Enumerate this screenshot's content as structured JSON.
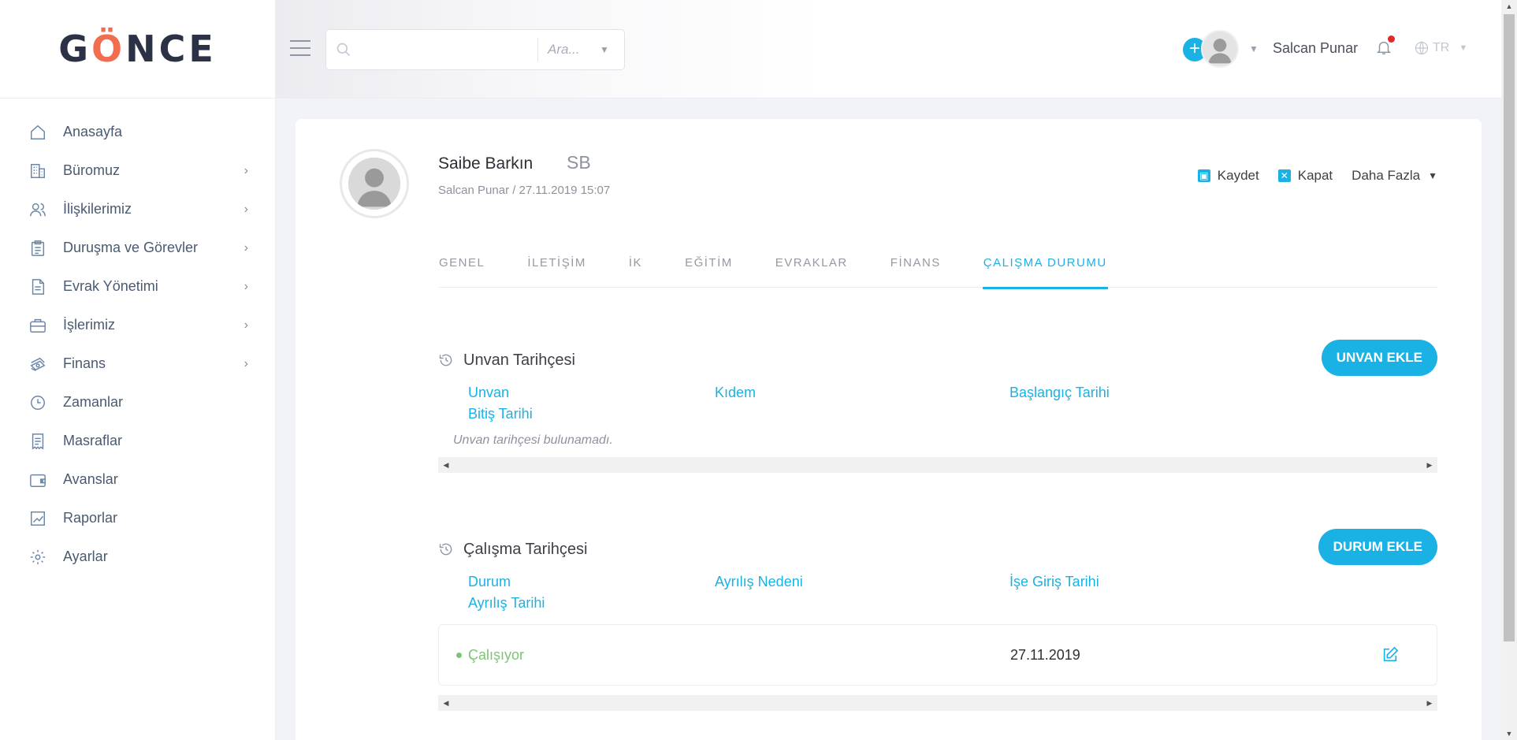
{
  "brand": {
    "logo_text_1": "G",
    "logo_text_2": "NCE"
  },
  "sidebar": {
    "items": [
      {
        "label": "Anasayfa",
        "icon": "home-icon",
        "has_children": false
      },
      {
        "label": "Büromuz",
        "icon": "building-icon",
        "has_children": true
      },
      {
        "label": "İlişkilerimiz",
        "icon": "users-icon",
        "has_children": true
      },
      {
        "label": "Duruşma ve Görevler",
        "icon": "clipboard-icon",
        "has_children": true
      },
      {
        "label": "Evrak Yönetimi",
        "icon": "document-icon",
        "has_children": true
      },
      {
        "label": "İşlerimiz",
        "icon": "briefcase-icon",
        "has_children": true
      },
      {
        "label": "Finans",
        "icon": "money-icon",
        "has_children": true
      },
      {
        "label": "Zamanlar",
        "icon": "clock-icon",
        "has_children": false
      },
      {
        "label": "Masraflar",
        "icon": "receipt-icon",
        "has_children": false
      },
      {
        "label": "Avanslar",
        "icon": "wallet-icon",
        "has_children": false
      },
      {
        "label": "Raporlar",
        "icon": "chart-icon",
        "has_children": false
      },
      {
        "label": "Ayarlar",
        "icon": "gear-icon",
        "has_children": false
      }
    ]
  },
  "header": {
    "search": {
      "value": "",
      "placeholder": "",
      "scope_placeholder": "Ara..."
    },
    "user_name": "Salcan Punar",
    "language": "TR"
  },
  "profile": {
    "name": "Saibe Barkın",
    "initials": "SB",
    "meta": "Salcan Punar / 27.11.2019 15:07",
    "actions": {
      "save": "Kaydet",
      "close": "Kapat",
      "more": "Daha Fazla"
    }
  },
  "tabs": [
    {
      "label": "GENEL",
      "active": false
    },
    {
      "label": "İLETİŞİM",
      "active": false
    },
    {
      "label": "İK",
      "active": false
    },
    {
      "label": "EĞİTİM",
      "active": false
    },
    {
      "label": "EVRAKLAR",
      "active": false
    },
    {
      "label": "FİNANS",
      "active": false
    },
    {
      "label": "ÇALIŞMA DURUMU",
      "active": true
    }
  ],
  "title_history": {
    "title": "Unvan Tarihçesi",
    "add_button": "UNVAN EKLE",
    "columns": [
      "Unvan",
      "Kıdem",
      "Başlangıç Tarihi",
      "Bitiş Tarihi"
    ],
    "empty_message": "Unvan tarihçesi bulunamadı."
  },
  "work_history": {
    "title": "Çalışma Tarihçesi",
    "add_button": "DURUM EKLE",
    "columns": [
      "Durum",
      "Ayrılış Nedeni",
      "İşe Giriş Tarihi",
      "Ayrılış Tarihi"
    ],
    "rows": [
      {
        "status": "Çalışıyor",
        "reason": "",
        "start_date": "27.11.2019",
        "end_date": ""
      }
    ]
  },
  "colors": {
    "accent": "#1ab2e5",
    "brand_orange": "#f26c4f",
    "status_active": "#7cc573"
  }
}
